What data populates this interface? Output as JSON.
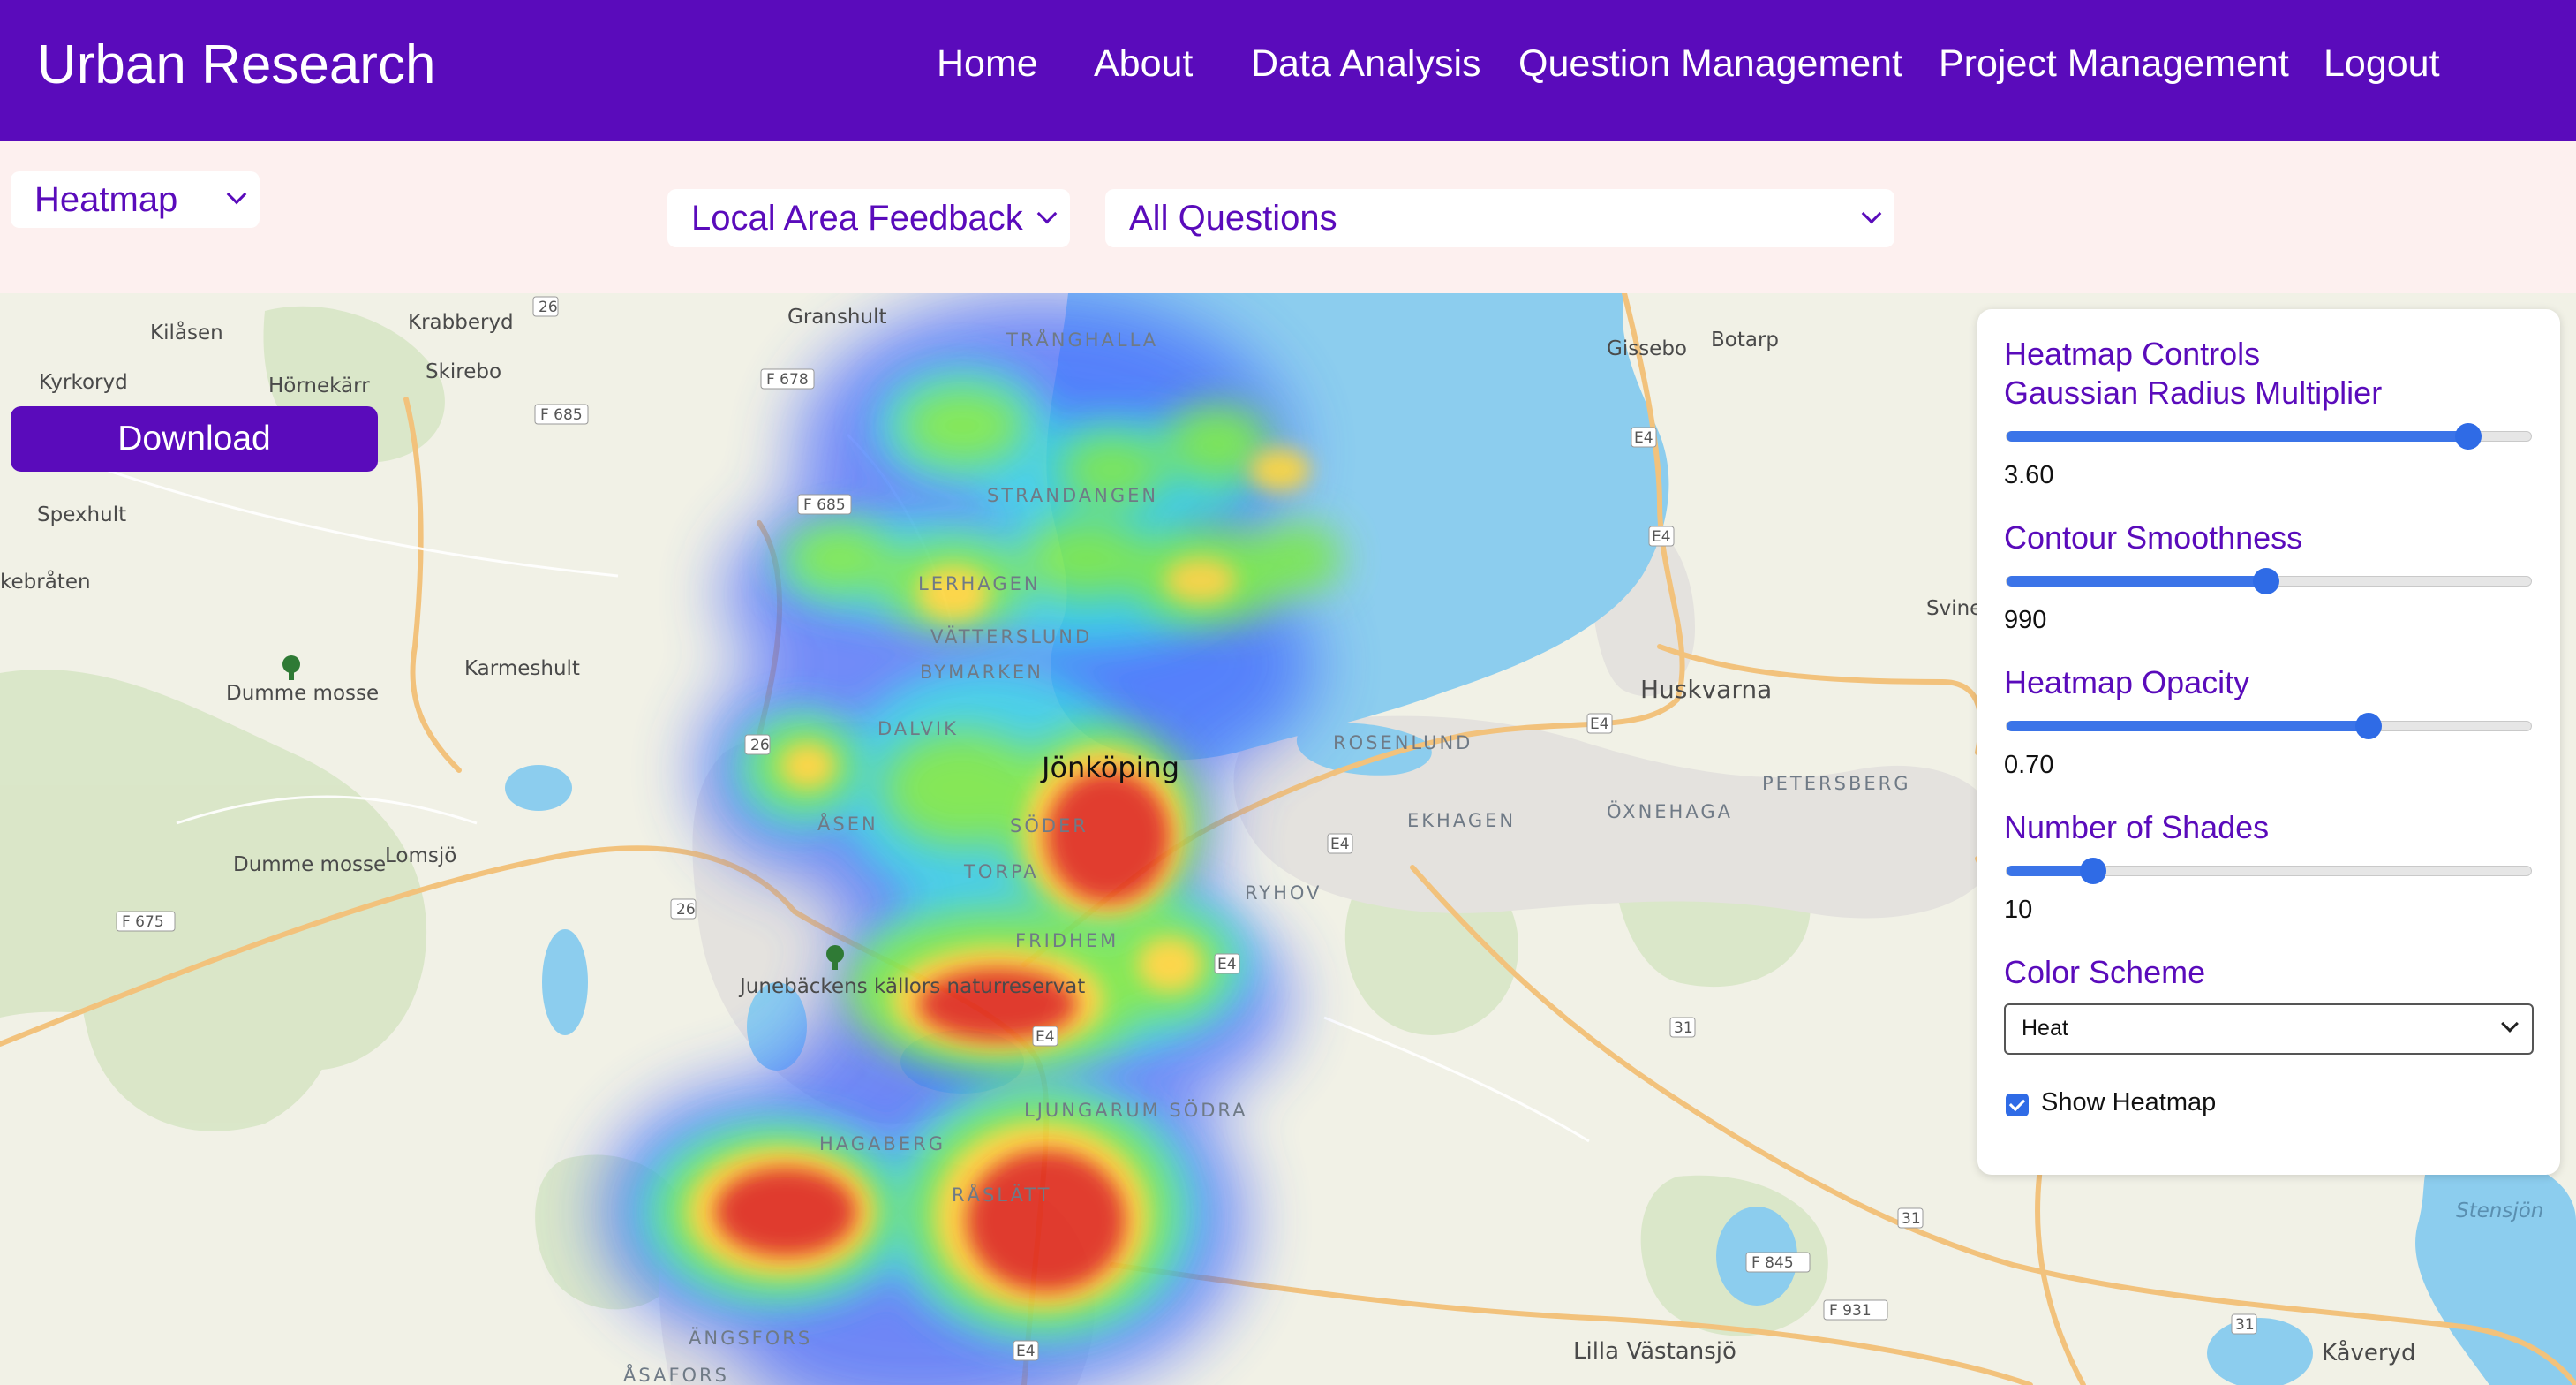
{
  "app": {
    "title": "Urban Research",
    "nav": [
      "Home",
      "About",
      "Data Analysis",
      "Question Management",
      "Project Management",
      "Logout"
    ]
  },
  "filters": {
    "view": "Heatmap",
    "category": "Local Area Feedback",
    "question": "All Questions"
  },
  "map": {
    "download_label": "Download",
    "city_label": "Jönköping",
    "places": [
      "Kilåsen",
      "Krabberyd",
      "Granshult",
      "Kyrkoryd",
      "Hörnekärr",
      "Skirebo",
      "Spexhult",
      "kebråten",
      "Dumme mosse",
      "Karmeshult",
      "Dumme mosse",
      "Lomsjö",
      "Junebäckens källors naturreservat",
      "Gissebo",
      "Botarp",
      "Huskvarna",
      "Svine",
      "Lilla Västansjö",
      "Kåveryd",
      "Stensjön"
    ],
    "districts": [
      "TRÅNGHALLA",
      "STRANDANGEN",
      "LERHAGEN",
      "VÄTTERSLUND",
      "BYMARKEN",
      "DALVIK",
      "ÅSEN",
      "SÖDER",
      "TORPA",
      "FRIDHEM",
      "ROSENLUND",
      "EKHAGEN",
      "ÖXNEHAGA",
      "PETERSBERG",
      "RYHOV",
      "LJUNGARUM SÖDRA",
      "HAGABERG",
      "RÅSLÄTT",
      "ÄNGSFORS",
      "ÅSAFORS"
    ],
    "road_shields": [
      "26",
      "F 678",
      "F 685",
      "F 685",
      "26",
      "F 675",
      "26",
      "E4",
      "E4",
      "E4",
      "E4",
      "E4",
      "E4",
      "E4",
      "31",
      "31",
      "31",
      "F 845",
      "F 931"
    ],
    "colors": {
      "water": "#8ccdee",
      "land": "#f1f1e6",
      "forest": "#d6e5c3",
      "urban": "#e5e3dd",
      "road": "#f2c27c"
    }
  },
  "controls": {
    "title": "Heatmap Controls",
    "radius_label": "Gaussian Radius Multiplier",
    "radius_value": "3.60",
    "radius_fraction": 0.88,
    "smoothness_label": "Contour Smoothness",
    "smoothness_value": "990",
    "smoothness_fraction": 0.495,
    "opacity_label": "Heatmap Opacity",
    "opacity_value": "0.70",
    "opacity_fraction": 0.69,
    "shades_label": "Number of Shades",
    "shades_value": "10",
    "shades_fraction": 0.165,
    "scheme_label": "Color Scheme",
    "scheme_value": "Heat",
    "show_label": "Show Heatmap",
    "show_checked": true
  },
  "colors": {
    "brand": "#5a0bbb",
    "filter_bg": "#fdf0ef",
    "slider": "#2f6be6"
  }
}
